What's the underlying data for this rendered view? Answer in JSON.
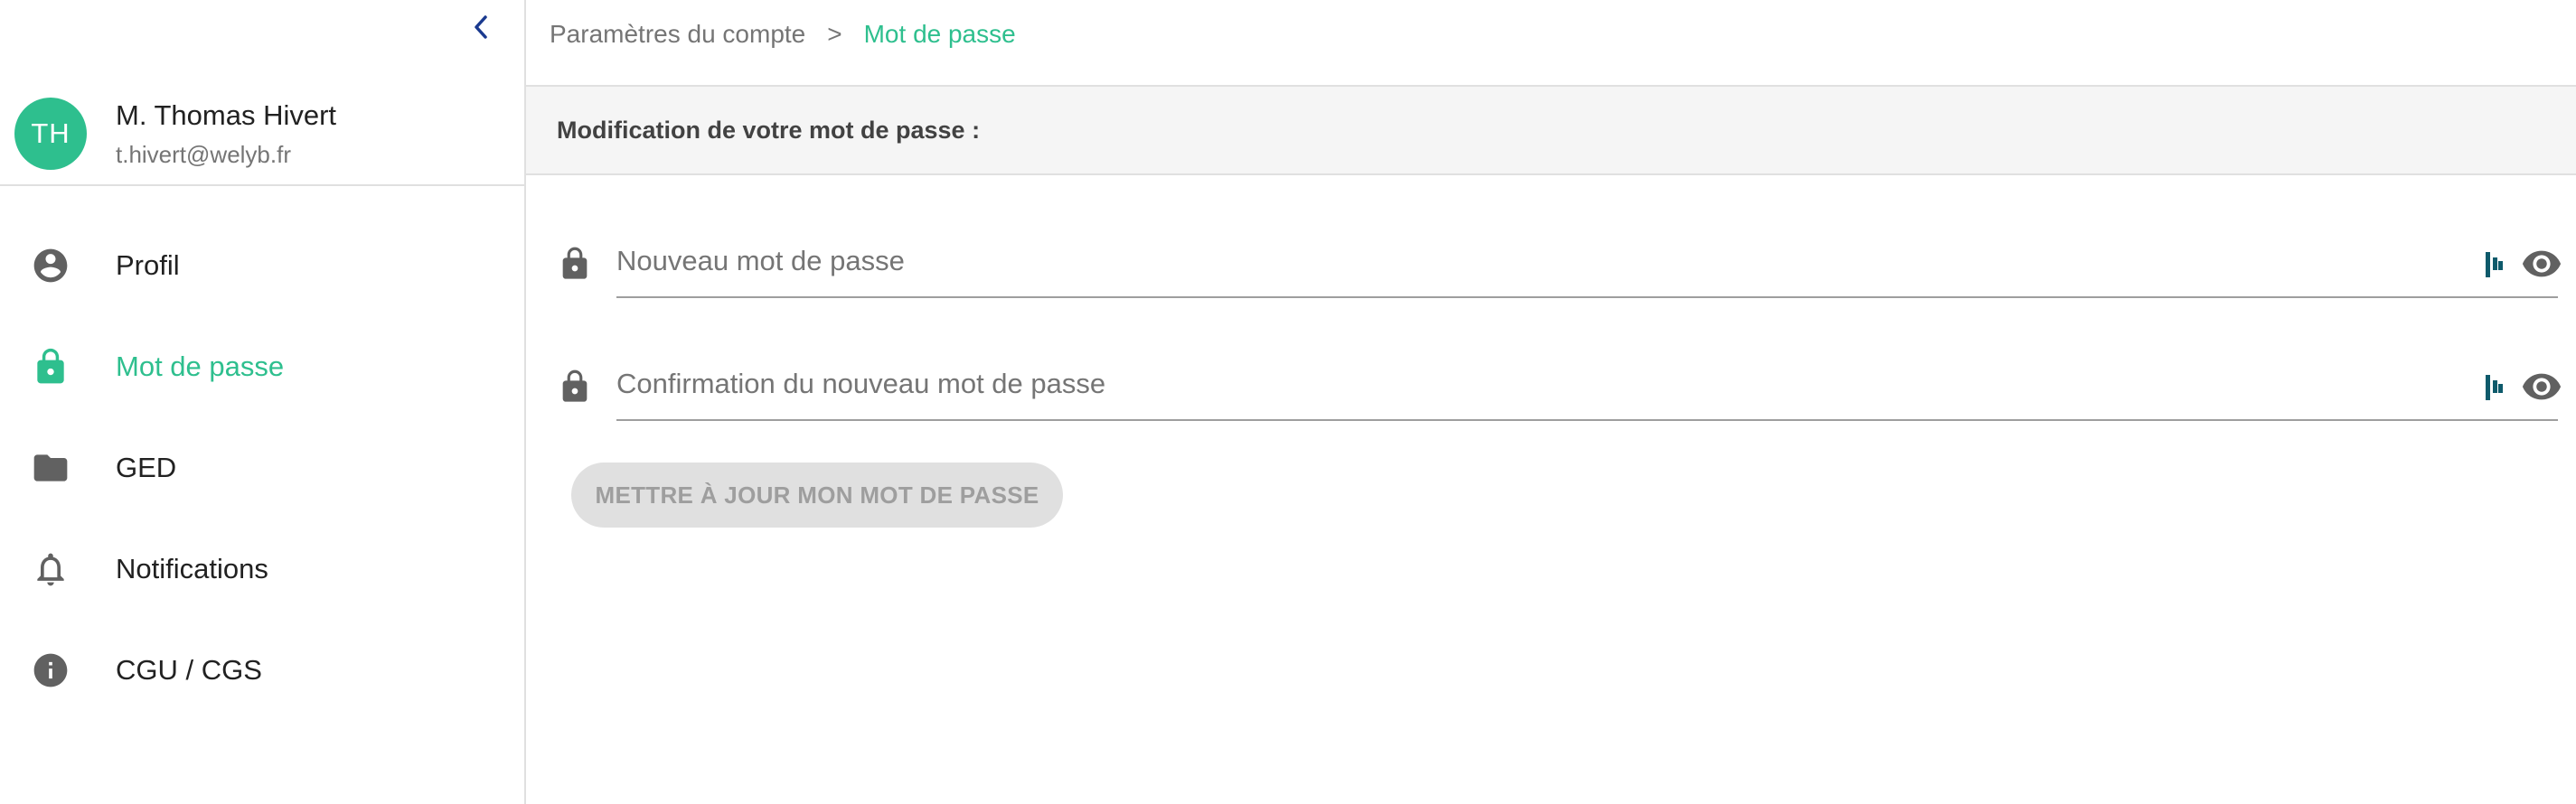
{
  "sidebar": {
    "collapse_icon": "chevron-left-icon",
    "user": {
      "initials": "TH",
      "name": "M. Thomas Hivert",
      "email": "t.hivert@welyb.fr",
      "avatar_color": "#2ebf8e"
    },
    "items": [
      {
        "label": "Profil",
        "icon": "account-circle-icon",
        "active": false
      },
      {
        "label": "Mot de passe",
        "icon": "lock-icon",
        "active": true
      },
      {
        "label": "GED",
        "icon": "folder-icon",
        "active": false
      },
      {
        "label": "Notifications",
        "icon": "bell-icon",
        "active": false
      },
      {
        "label": "CGU / CGS",
        "icon": "info-icon",
        "active": false
      }
    ]
  },
  "breadcrumb": {
    "parent": "Paramètres du compte",
    "separator": ">",
    "current": "Mot de passe"
  },
  "section": {
    "title": "Modification de votre mot de passe :"
  },
  "form": {
    "new_password": {
      "placeholder": "Nouveau mot de passe",
      "value": ""
    },
    "confirm_password": {
      "placeholder": "Confirmation du nouveau mot de passe",
      "value": ""
    },
    "submit_label": "METTRE À JOUR MON MOT DE PASSE"
  },
  "colors": {
    "accent": "#2ebf8e",
    "icon_gray": "#616161",
    "collapse_blue": "#1a3a8f",
    "extension_teal": "#0e5a6b"
  }
}
